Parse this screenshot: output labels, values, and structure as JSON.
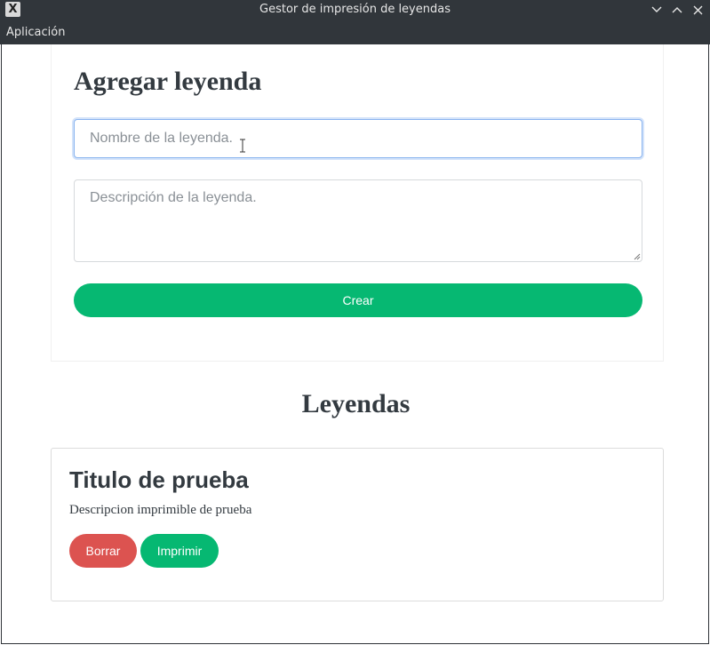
{
  "window": {
    "title": "Gestor de impresión de leyendas",
    "app_icon_glyph": "X"
  },
  "menubar": {
    "items": [
      "Aplicación"
    ]
  },
  "form": {
    "heading": "Agregar leyenda",
    "name_placeholder": "Nombre de la leyenda.",
    "name_value": "",
    "description_placeholder": "Descripción de la leyenda.",
    "description_value": "",
    "create_label": "Crear"
  },
  "legends": {
    "heading": "Leyendas",
    "items": [
      {
        "title": "Titulo de prueba",
        "description": "Descripcion imprimible de prueba",
        "delete_label": "Borrar",
        "print_label": "Imprimir"
      }
    ]
  },
  "colors": {
    "titlebar": "#31363b",
    "primary_green": "#06b872",
    "danger_red": "#dc5350",
    "heading_text": "#333a40",
    "focus_border": "#8ab4ef"
  },
  "icons": {
    "minimize": "chevron-down-icon",
    "maximize": "chevron-up-icon",
    "close": "close-icon"
  }
}
